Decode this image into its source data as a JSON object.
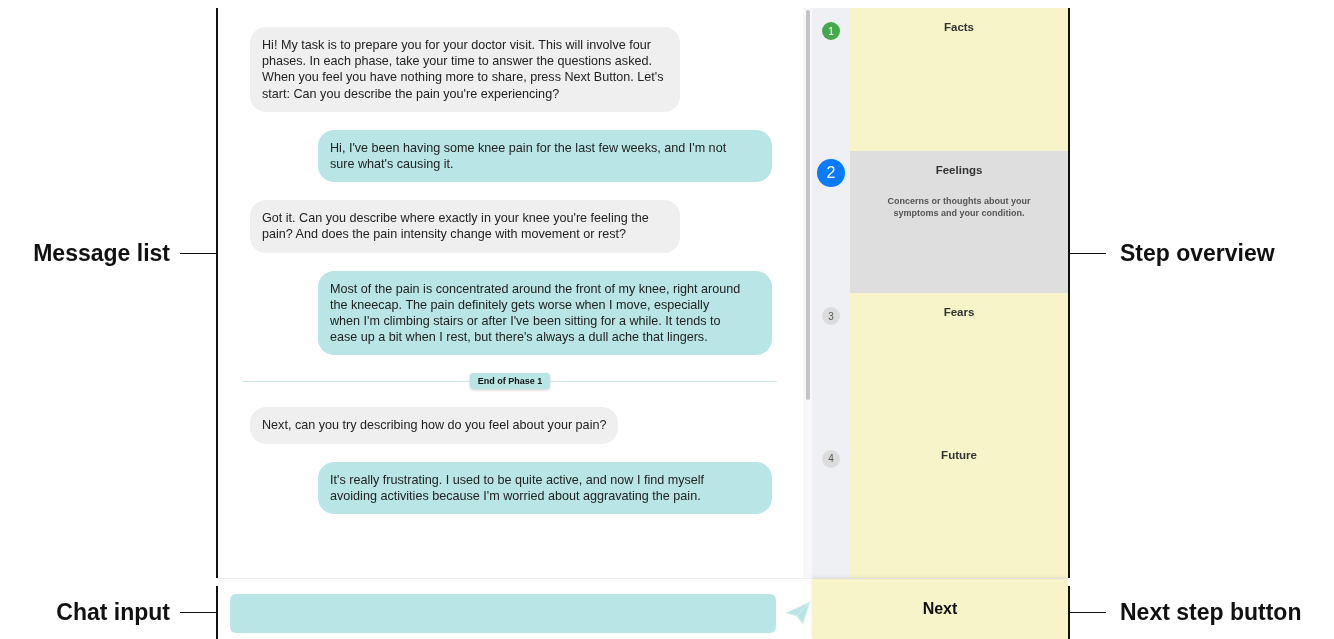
{
  "annotations": {
    "left": [
      "Message list",
      "Chat input"
    ],
    "right": [
      "Step overview",
      "Next step button"
    ]
  },
  "messages": [
    {
      "kind": "bot",
      "text": "Hi! My task is to prepare you for your doctor visit. This will involve four phases. In each phase, take your time to answer the questions asked. When you feel you have nothing more to share, press Next Button. Let's start: Can you describe the pain you're experiencing?"
    },
    {
      "kind": "user",
      "text": "Hi, I've been having some knee pain for the last few weeks, and I'm not sure what's causing it."
    },
    {
      "kind": "bot",
      "text": "Got it. Can you describe where exactly in your knee you're feeling the pain? And does the pain intensity change with movement or rest?"
    },
    {
      "kind": "user",
      "text": "Most of the pain is concentrated around the front of my knee, right around the kneecap. The pain definitely gets worse when I move, especially when I'm climbing stairs or after I've been sitting for a while. It tends to ease up a bit when I rest, but there's always a dull ache that lingers."
    },
    {
      "kind": "divider",
      "text": "End of Phase 1"
    },
    {
      "kind": "bot",
      "text": "Next, can you try describing how do you feel about your pain?"
    },
    {
      "kind": "user",
      "text": "It's really frustrating. I used to be quite active, and now I find myself avoiding activities because I'm worried about aggravating the pain."
    }
  ],
  "steps": [
    {
      "number": "1",
      "title": "Facts",
      "color": "#45a84a",
      "selected": false
    },
    {
      "number": "2",
      "title": "Feelings",
      "color": "#0a7bff",
      "selected": true,
      "description": "Concerns or thoughts about your symptoms and your condition."
    },
    {
      "number": "3",
      "title": "Fears",
      "color": "#dcdcdc",
      "selected": false
    },
    {
      "number": "4",
      "title": "Future",
      "color": "#dcdcdc",
      "selected": false
    }
  ],
  "next_button": "Next"
}
